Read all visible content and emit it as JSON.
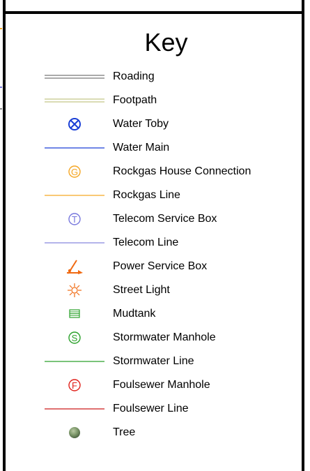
{
  "key": {
    "title": "Key",
    "items": [
      {
        "label": "Roading",
        "icon": "double-line-icon",
        "color": "#555555"
      },
      {
        "label": "Footpath",
        "icon": "double-line-icon",
        "color": "#b5b96a"
      },
      {
        "label": "Water Toby",
        "icon": "circle-x-icon",
        "color": "#1a3fd6"
      },
      {
        "label": "Water Main",
        "icon": "line-icon",
        "color": "#1a3fd6"
      },
      {
        "label": "Rockgas House Connection",
        "icon": "circle-g-icon",
        "color": "#f5a623"
      },
      {
        "label": "Rockgas Line",
        "icon": "line-icon",
        "color": "#f5a623"
      },
      {
        "label": "Telecom Service Box",
        "icon": "circle-t-icon",
        "color": "#7777dd"
      },
      {
        "label": "Telecom Line",
        "icon": "line-icon",
        "color": "#8888dd"
      },
      {
        "label": "Power Service Box",
        "icon": "power-icon",
        "color": "#f06a12"
      },
      {
        "label": "Street Light",
        "icon": "sun-icon",
        "color": "#f06a12"
      },
      {
        "label": "Mudtank",
        "icon": "mudtank-icon",
        "color": "#2aa12a"
      },
      {
        "label": "Stormwater Manhole",
        "icon": "circle-s-icon",
        "color": "#2aa12a"
      },
      {
        "label": "Stormwater Line",
        "icon": "line-icon",
        "color": "#2aa12a"
      },
      {
        "label": "Foulsewer Manhole",
        "icon": "circle-f-icon",
        "color": "#e0201a"
      },
      {
        "label": "Foulsewer Line",
        "icon": "line-icon",
        "color": "#cc1a1a"
      },
      {
        "label": "Tree",
        "icon": "tree-icon",
        "color": "#6f8a5f"
      }
    ]
  }
}
